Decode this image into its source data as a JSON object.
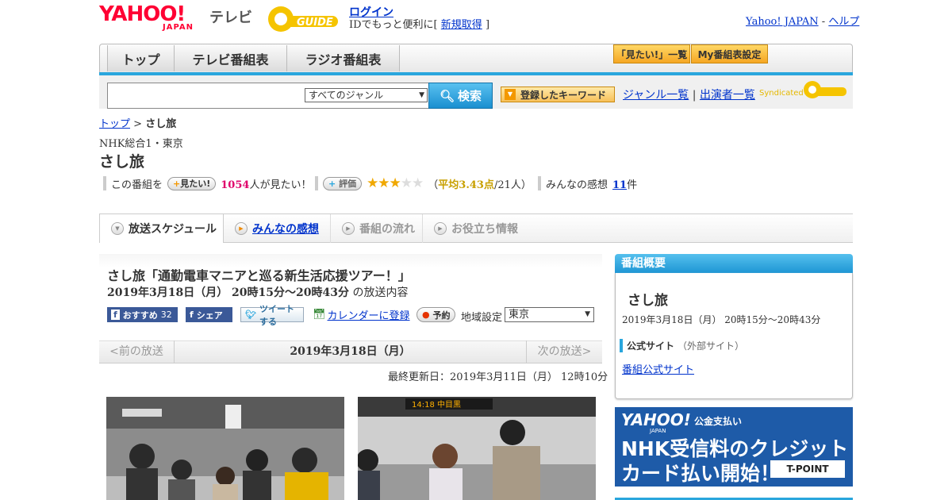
{
  "header": {
    "logo_main": "YAHOO!",
    "logo_sub": "JAPAN",
    "logo_tv": "テレビ",
    "gguide_logo": "G-GUIDE",
    "login": "ログイン",
    "login_prefix": "IDでもっと便利に[",
    "login_signup": "新規取得",
    "login_suffix": "]",
    "yahoo_japan_link": "Yahoo! JAPAN",
    "help_link": "ヘルプ",
    "sep": "-"
  },
  "nav": {
    "tabs": [
      "トップ",
      "テレビ番組表",
      "ラジオ番組表"
    ],
    "mitai_list": "「見たい!」一覧",
    "my_schedule": "My番組表設定"
  },
  "search": {
    "genre_selected": "すべてのジャンル",
    "button": "検索",
    "keyword_button": "登録したキーワード",
    "genre_list": "ジャンル一覧",
    "performer_list": "出演者一覧",
    "divider": "|",
    "syndicated": "Syndicated"
  },
  "breadcrumb": {
    "top": "トップ",
    "sep": ">",
    "current": "さし旅"
  },
  "program": {
    "channel": "NHK総合1・東京",
    "title": "さし旅",
    "mitai_prefix": "この番組を",
    "mitai_button": "見たい!",
    "mitai_count": "1054",
    "mitai_suffix": "人が見たい！",
    "rate_button": "評価",
    "rating_avg_label": "平均3.43点",
    "rating_count": "/21人）",
    "rating_open": "（",
    "rating_value": 3.43,
    "impressions_label": "みんなの感想",
    "impressions_count": "11",
    "impressions_suffix": "件"
  },
  "tabs": [
    "放送スケジュール",
    "みんなの感想",
    "番組の流れ",
    "お役立ち情報"
  ],
  "episode": {
    "title": "さし旅「通勤電車マニアと巡る新生活応援ツアー！」",
    "date_time": "2019年3月18日（月）  20時15分～20時43分",
    "date_suffix": "の放送内容",
    "recommend": "おすすめ",
    "recommend_count": "32",
    "share": "シェア",
    "tweet": "ツイートする",
    "calendar": "カレンダーに登録",
    "reserve": "予約",
    "region_label": "地域設定",
    "region_value": "東京",
    "prev": "<前の放送",
    "current_date": "2019年3月18日（月）",
    "next": "次の放送>",
    "updated": "最終更新日：2019年3月11日（月）  12時10分"
  },
  "sidebar": {
    "heading": "番組概要",
    "title": "さし旅",
    "date_time": "2019年3月18日（月）  20時15分～20時43分",
    "official_label": "公式サイト",
    "official_note": "（外部サイト）",
    "official_link": "番組公式サイト"
  },
  "ad": {
    "logo": "YAHOO!",
    "logo_sub": "JAPAN",
    "service": "公金支払い",
    "line1": "NHK受信料のクレジット",
    "line2": "カード払い開始！",
    "tpoint": "T-POINT"
  },
  "photo_board": "14:18 中目黒"
}
